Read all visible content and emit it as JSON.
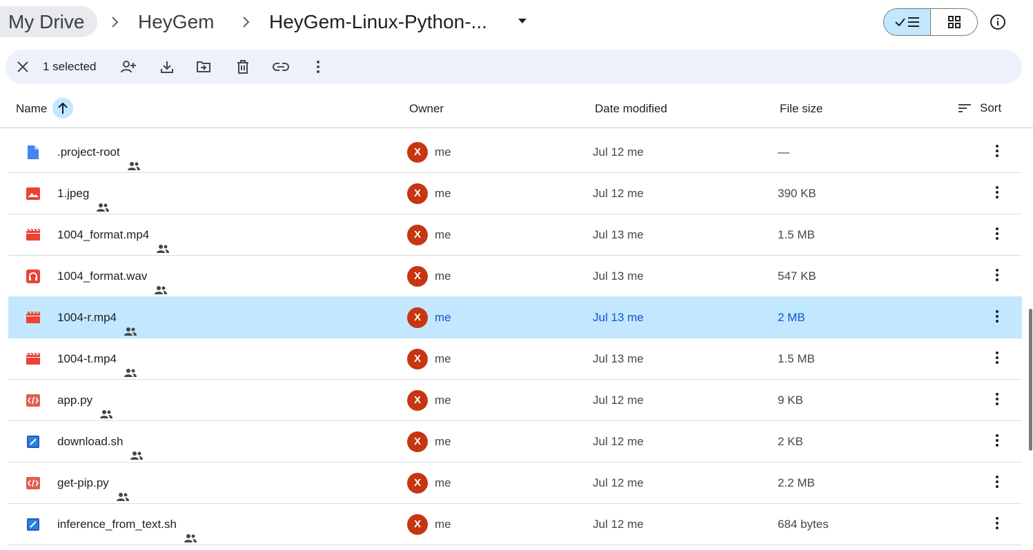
{
  "breadcrumb": {
    "root": "My Drive",
    "parent": "HeyGem",
    "current": "HeyGem-Linux-Python-..."
  },
  "view": {
    "mode": "list"
  },
  "selection": {
    "count_label": "1 selected"
  },
  "columns": {
    "name": "Name",
    "owner": "Owner",
    "date_modified": "Date modified",
    "file_size": "File size",
    "sort": "Sort"
  },
  "colors": {
    "selected_row": "#c2e7ff",
    "selection_bar": "#edf2fa",
    "avatar": "#c53611",
    "selected_text": "#0b57d0"
  },
  "files": [
    {
      "name": ".project-root",
      "icon": "document-icon",
      "owner_initial": "X",
      "owner": "me",
      "date": "Jul 12 me",
      "size": "—",
      "selected": false
    },
    {
      "name": "1.jpeg",
      "icon": "image-icon",
      "owner_initial": "X",
      "owner": "me",
      "date": "Jul 12 me",
      "size": "390 KB",
      "selected": false
    },
    {
      "name": "1004_format.mp4",
      "icon": "video-icon",
      "owner_initial": "X",
      "owner": "me",
      "date": "Jul 13 me",
      "size": "1.5 MB",
      "selected": false
    },
    {
      "name": "1004_format.wav",
      "icon": "audio-icon",
      "owner_initial": "X",
      "owner": "me",
      "date": "Jul 13 me",
      "size": "547 KB",
      "selected": false
    },
    {
      "name": "1004-r.mp4",
      "icon": "video-icon",
      "owner_initial": "X",
      "owner": "me",
      "date": "Jul 13 me",
      "size": "2 MB",
      "selected": true
    },
    {
      "name": "1004-t.mp4",
      "icon": "video-icon",
      "owner_initial": "X",
      "owner": "me",
      "date": "Jul 13 me",
      "size": "1.5 MB",
      "selected": false
    },
    {
      "name": "app.py",
      "icon": "code-icon",
      "owner_initial": "X",
      "owner": "me",
      "date": "Jul 12 me",
      "size": "9 KB",
      "selected": false
    },
    {
      "name": "download.sh",
      "icon": "script-icon",
      "owner_initial": "X",
      "owner": "me",
      "date": "Jul 12 me",
      "size": "2 KB",
      "selected": false
    },
    {
      "name": "get-pip.py",
      "icon": "code-icon",
      "owner_initial": "X",
      "owner": "me",
      "date": "Jul 12 me",
      "size": "2.2 MB",
      "selected": false
    },
    {
      "name": "inference_from_text.sh",
      "icon": "script-icon",
      "owner_initial": "X",
      "owner": "me",
      "date": "Jul 12 me",
      "size": "684 bytes",
      "selected": false
    }
  ]
}
